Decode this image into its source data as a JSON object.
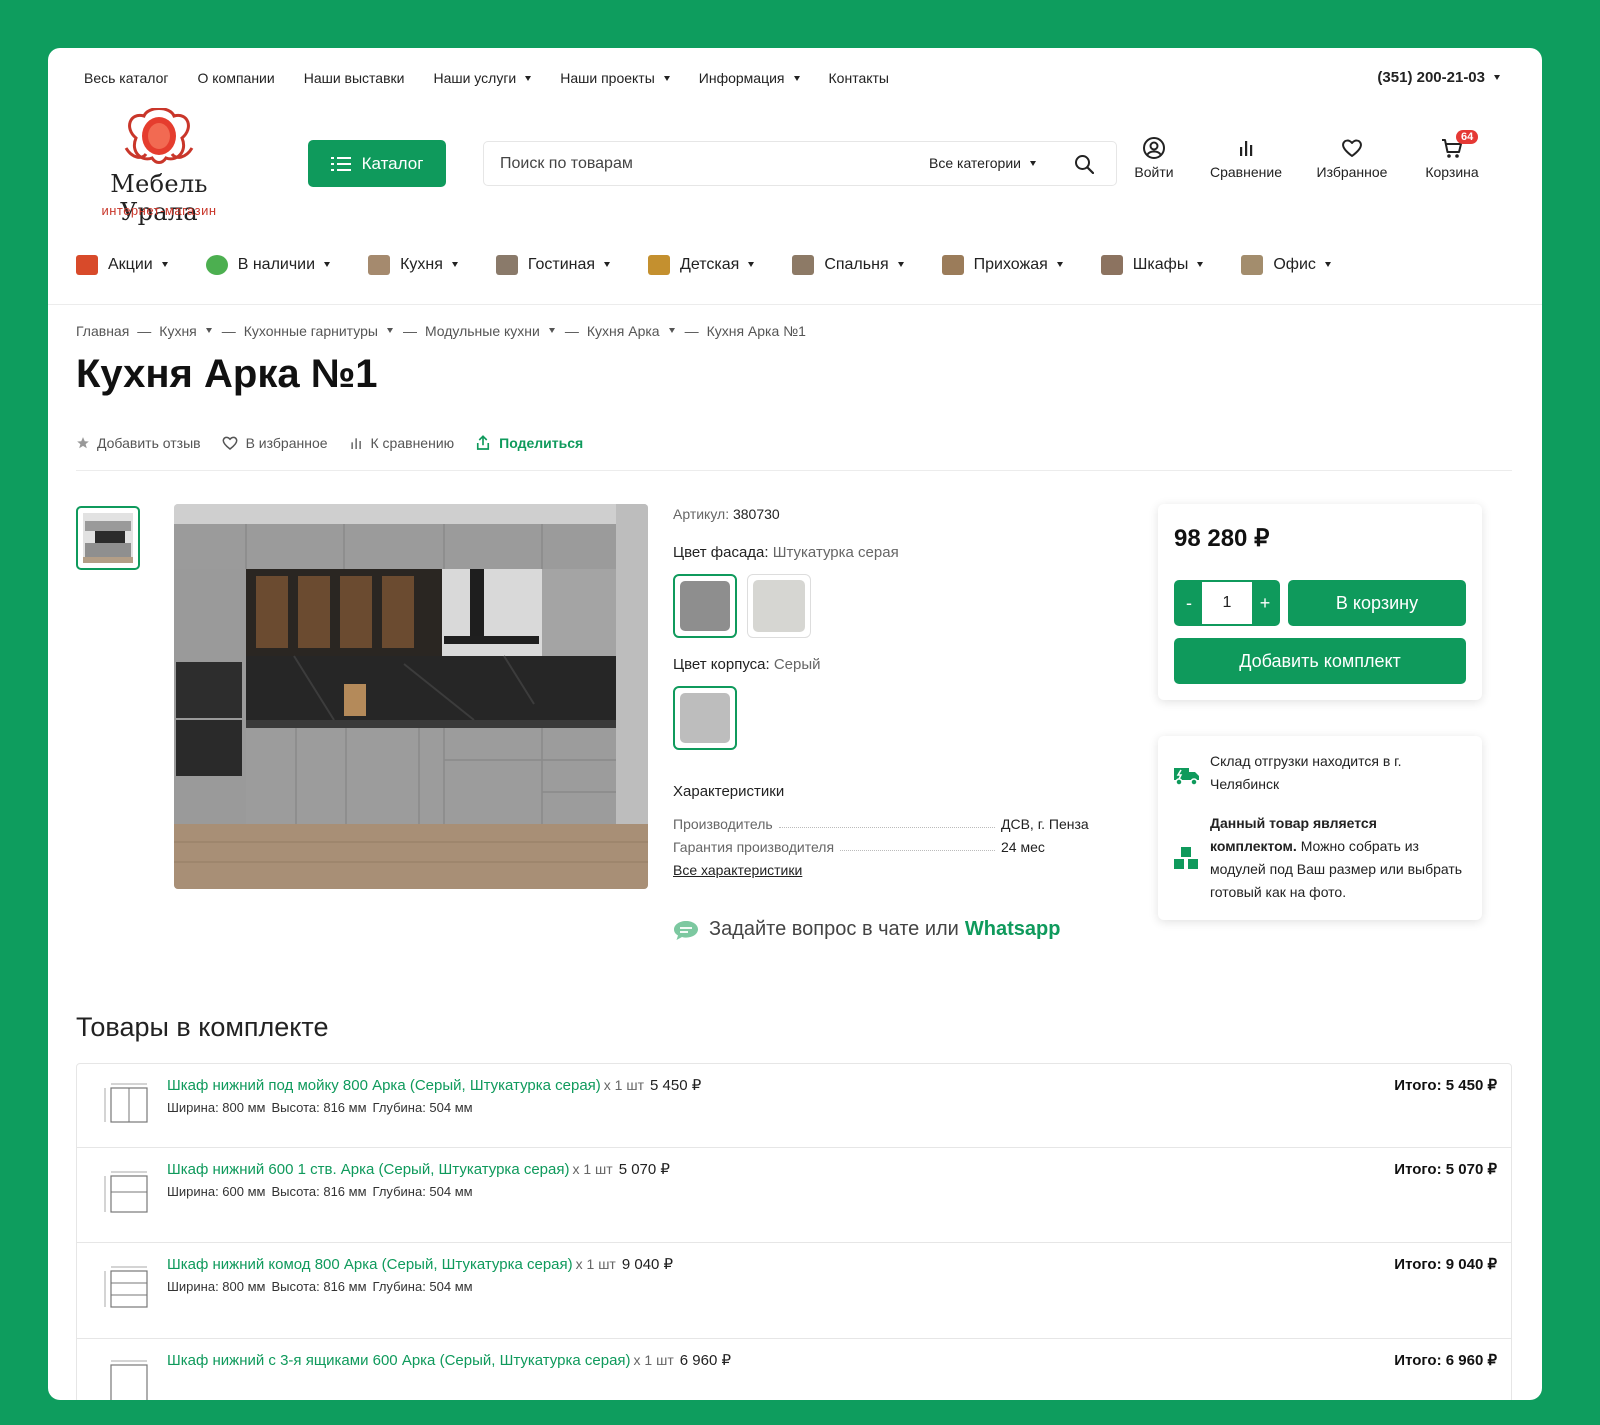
{
  "top_nav": {
    "items": [
      {
        "label": "Весь каталог",
        "caret": false
      },
      {
        "label": "О компании",
        "caret": false
      },
      {
        "label": "Наши выставки",
        "caret": false
      },
      {
        "label": "Наши услуги",
        "caret": true
      },
      {
        "label": "Наши проекты",
        "caret": true
      },
      {
        "label": "Информация",
        "caret": true
      },
      {
        "label": "Контакты",
        "caret": false
      }
    ],
    "phone": "(351) 200-21-03"
  },
  "logo": {
    "name": "Мебель Урала",
    "subtitle": "интернет-магазин"
  },
  "header": {
    "catalog_label": "Каталог",
    "search_placeholder": "Поиск по товарам",
    "search_category": "Все категории",
    "login_label": "Войти",
    "compare_label": "Сравнение",
    "favorites_label": "Избранное",
    "cart_label": "Корзина",
    "cart_count": "64"
  },
  "main_menu": [
    {
      "label": "Акции",
      "icon": "sale-icon",
      "color": "#d84a2a"
    },
    {
      "label": "В наличии",
      "icon": "in-stock-icon",
      "color": "#4caf50"
    },
    {
      "label": "Кухня",
      "icon": "kitchen-icon",
      "color": "#a58a6e"
    },
    {
      "label": "Гостиная",
      "icon": "living-room-icon",
      "color": "#8a7a6a"
    },
    {
      "label": "Детская",
      "icon": "kids-room-icon",
      "color": "#c4902f"
    },
    {
      "label": "Спальня",
      "icon": "bedroom-icon",
      "color": "#8d7a66"
    },
    {
      "label": "Прихожая",
      "icon": "hallway-icon",
      "color": "#9b7c5a"
    },
    {
      "label": "Шкафы",
      "icon": "wardrobe-icon",
      "color": "#8c7360"
    },
    {
      "label": "Офис",
      "icon": "office-icon",
      "color": "#a38d6d"
    }
  ],
  "breadcrumb": [
    {
      "label": "Главная",
      "caret": false
    },
    {
      "label": "Кухня",
      "caret": true
    },
    {
      "label": "Кухонные гарнитуры",
      "caret": true
    },
    {
      "label": "Модульные кухни",
      "caret": true
    },
    {
      "label": "Кухня Арка",
      "caret": true
    },
    {
      "label": "Кухня Арка №1",
      "caret": false
    }
  ],
  "product": {
    "title": "Кухня Арка №1",
    "actions": {
      "review": "Добавить отзыв",
      "favorite": "В избранное",
      "compare": "К сравнению",
      "share": "Поделиться"
    },
    "article_label": "Артикул:",
    "article": "380730",
    "facade_label": "Цвет фасада:",
    "facade_value": "Штукатурка серая",
    "facade_swatches": [
      "#8e8e8e",
      "#d6d6d2"
    ],
    "body_label": "Цвет корпуса:",
    "body_value": "Серый",
    "body_swatches": [
      "#bdbdbd"
    ],
    "chars_title": "Характеристики",
    "chars": [
      {
        "key": "Производитель",
        "value": "ДСВ, г. Пенза"
      },
      {
        "key": "Гарантия производителя",
        "value": "24 мес"
      }
    ],
    "all_chars": "Все характеристики",
    "ask_text": "Задайте вопрос в чате или",
    "ask_link": "Whatsapp",
    "price": "98 280 ₽",
    "qty": "1",
    "qty_minus": "-",
    "qty_plus": "+",
    "to_cart": "В корзину",
    "add_set": "Добавить комплект",
    "warehouse": "Склад отгрузки находится в г. Челябинск",
    "set_note_bold": "Данный товар является комплектом.",
    "set_note": "Можно собрать из модулей под Ваш размер или выбрать готовый как на фото."
  },
  "set_section": {
    "title": "Товары в комплекте",
    "items": [
      {
        "name": "Шкаф нижний под мойку 800 Арка (Серый, Штукатурка серая)",
        "qty": "x 1 шт",
        "price": "5 450 ₽",
        "width": "Ширина: 800 мм",
        "height": "Высота: 816 мм",
        "depth": "Глубина: 504 мм",
        "total": "Итого: 5 450 ₽"
      },
      {
        "name": "Шкаф нижний 600 1 ств. Арка (Серый, Штукатурка серая)",
        "qty": "x 1 шт",
        "price": "5 070 ₽",
        "width": "Ширина: 600 мм",
        "height": "Высота: 816 мм",
        "depth": "Глубина: 504 мм",
        "total": "Итого: 5 070 ₽"
      },
      {
        "name": "Шкаф нижний комод 800 Арка (Серый, Штукатурка серая)",
        "qty": "x 1 шт",
        "price": "9 040 ₽",
        "width": "Ширина: 800 мм",
        "height": "Высота: 816 мм",
        "depth": "Глубина: 504 мм",
        "total": "Итого: 9 040 ₽"
      },
      {
        "name": "Шкаф нижний с 3-я ящиками 600 Арка (Серый, Штукатурка серая)",
        "qty": "x 1 шт",
        "price": "6 960 ₽",
        "width": "",
        "height": "",
        "depth": "",
        "total": "Итого: 6 960 ₽"
      }
    ]
  },
  "colors": {
    "accent": "#0f9a5c",
    "badge": "#e53935",
    "logo_red": "#c9362a"
  }
}
